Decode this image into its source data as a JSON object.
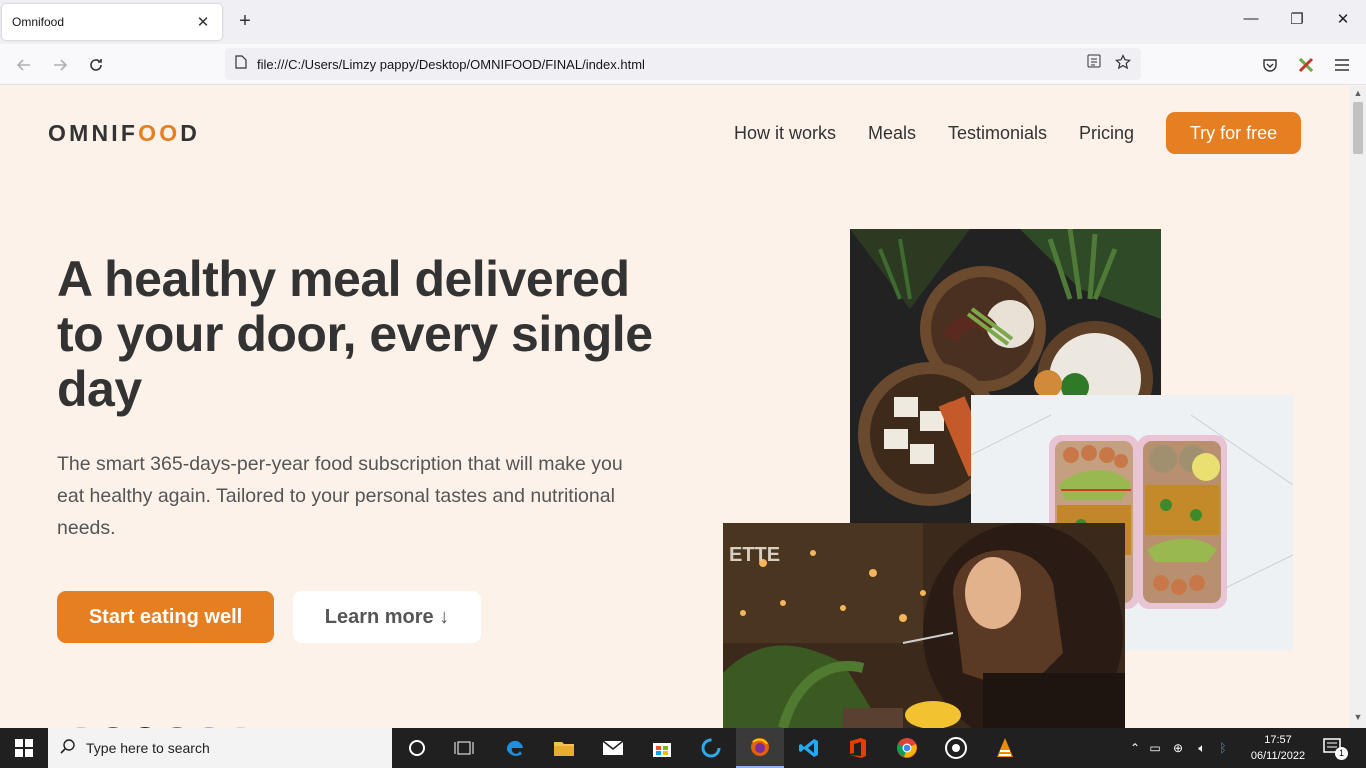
{
  "browser": {
    "tab_title": "Omnifood",
    "url": "file:///C:/Users/Limzy pappy/Desktop/OMNIFOOD/FINAL/index.html"
  },
  "site": {
    "logo_prefix": "OMNIF",
    "logo_oo": "OO",
    "logo_suffix": "D",
    "nav": [
      "How it works",
      "Meals",
      "Testimonials",
      "Pricing"
    ],
    "nav_cta": "Try for free",
    "hero_title": "A healthy meal delivered to your door, every single day",
    "hero_text": "The smart 365-days-per-year food subscription that will make you eat healthy again. Tailored to your personal tastes and nutritional needs.",
    "btn_primary": "Start eating well",
    "btn_secondary": "Learn more ↓",
    "accent_color": "#e67e22",
    "background_color": "#fdf2e9"
  },
  "taskbar": {
    "search_placeholder": "Type here to search",
    "time": "17:57",
    "date": "06/11/2022",
    "notification_count": "1"
  }
}
